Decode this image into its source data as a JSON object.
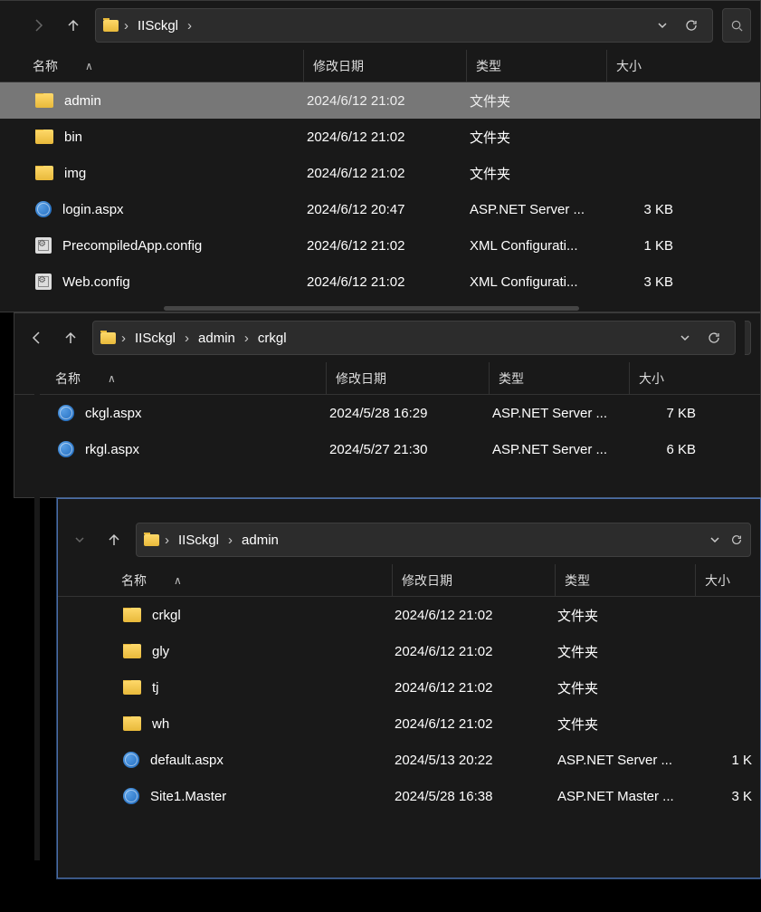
{
  "columns": {
    "name": "名称",
    "date": "修改日期",
    "type": "类型",
    "size": "大小"
  },
  "w1": {
    "breadcrumb": [
      "IISckgl"
    ],
    "rows": [
      {
        "icon": "folder",
        "name": "admin",
        "date": "2024/6/12 21:02",
        "type": "文件夹",
        "size": "",
        "selected": true
      },
      {
        "icon": "folder",
        "name": "bin",
        "date": "2024/6/12 21:02",
        "type": "文件夹",
        "size": ""
      },
      {
        "icon": "folder",
        "name": "img",
        "date": "2024/6/12 21:02",
        "type": "文件夹",
        "size": ""
      },
      {
        "icon": "web",
        "name": "login.aspx",
        "date": "2024/6/12 20:47",
        "type": "ASP.NET Server ...",
        "size": "3 KB"
      },
      {
        "icon": "config",
        "name": "PrecompiledApp.config",
        "date": "2024/6/12 21:02",
        "type": "XML Configurati...",
        "size": "1 KB"
      },
      {
        "icon": "config",
        "name": "Web.config",
        "date": "2024/6/12 21:02",
        "type": "XML Configurati...",
        "size": "3 KB"
      }
    ],
    "cols": "300px 180px 155px 90px"
  },
  "w2": {
    "breadcrumb": [
      "IISckgl",
      "admin",
      "crkgl"
    ],
    "rows": [
      {
        "icon": "web",
        "name": "ckgl.aspx",
        "date": "2024/5/28 16:29",
        "type": "ASP.NET Server ...",
        "size": "7 KB"
      },
      {
        "icon": "web",
        "name": "rkgl.aspx",
        "date": "2024/5/27 21:30",
        "type": "ASP.NET Server ...",
        "size": "6 KB"
      }
    ],
    "cols": "300px 180px 155px 90px"
  },
  "w3": {
    "breadcrumb": [
      "IISckgl",
      "admin"
    ],
    "rows": [
      {
        "icon": "folder",
        "name": "crkgl",
        "date": "2024/6/12 21:02",
        "type": "文件夹",
        "size": ""
      },
      {
        "icon": "folder",
        "name": "gly",
        "date": "2024/6/12 21:02",
        "type": "文件夹",
        "size": ""
      },
      {
        "icon": "folder",
        "name": "tj",
        "date": "2024/6/12 21:02",
        "type": "文件夹",
        "size": ""
      },
      {
        "icon": "folder",
        "name": "wh",
        "date": "2024/6/12 21:02",
        "type": "文件夹",
        "size": ""
      },
      {
        "icon": "web",
        "name": "default.aspx",
        "date": "2024/5/13 20:22",
        "type": "ASP.NET Server ...",
        "size": "1 K"
      },
      {
        "icon": "web",
        "name": "Site1.Master",
        "date": "2024/5/28 16:38",
        "type": "ASP.NET Master ...",
        "size": "3 K"
      }
    ],
    "cols": "300px 180px 155px 80px"
  }
}
